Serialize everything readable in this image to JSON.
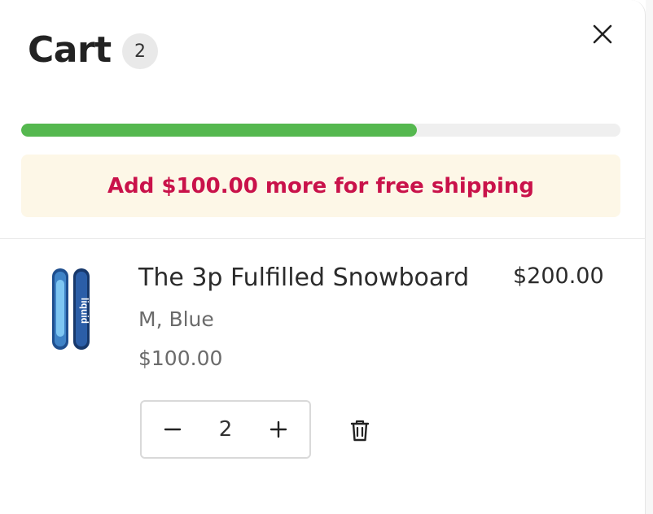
{
  "header": {
    "title": "Cart",
    "count": "2"
  },
  "shipping": {
    "progress_percent": 66,
    "message": "Add $100.00 more for free shipping",
    "bar_color": "#55b84f",
    "message_color": "#c9124a",
    "notice_bg": "#fdf7e7"
  },
  "cart_items": [
    {
      "title": "The 3p Fulfilled Snowboard",
      "variant": "M,  Blue",
      "unit_price": "$100.00",
      "line_total": "$200.00",
      "quantity": "2",
      "image_text": "liquid"
    }
  ],
  "icons": {
    "close": "close-icon",
    "minus": "minus-icon",
    "plus": "plus-icon",
    "trash": "trash-icon"
  }
}
